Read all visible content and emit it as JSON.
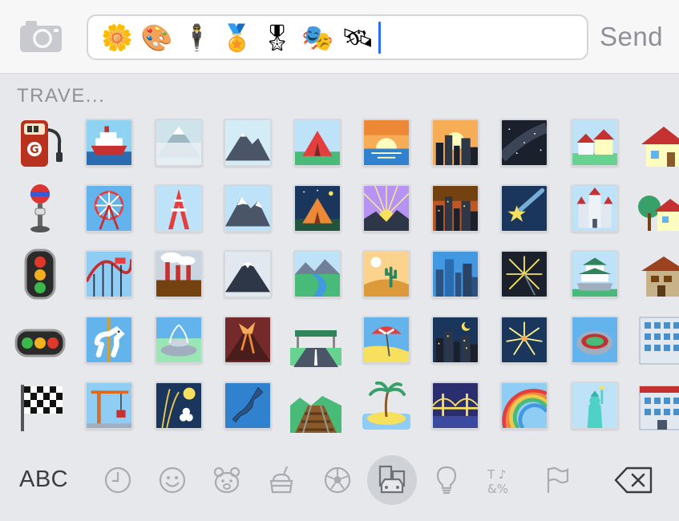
{
  "compose": {
    "send_label": "Send",
    "typed_emoji": [
      "🌼",
      "🎨",
      "🕴",
      "🏅",
      "🎖",
      "🎭",
      "🛰"
    ]
  },
  "emoji_panel": {
    "category_label": "TRAVE...",
    "columns": [
      [
        "fuel-pump",
        "busstop",
        "traffic-light-vertical",
        "traffic-light-horizontal",
        "checkered-flag"
      ],
      [
        "ship",
        "ferris-wheel",
        "roller-coaster",
        "carousel-horse",
        "construction-crane"
      ],
      [
        "mount-fuji-mist",
        "tokyo-tower",
        "factory",
        "fountain",
        "moon-viewing"
      ],
      [
        "mountain",
        "snow-mountain",
        "mount-fuji",
        "volcano",
        "japan-map"
      ],
      [
        "tent-day",
        "tent-night",
        "river-park",
        "motorway",
        "railway-track"
      ],
      [
        "sunrise",
        "sunrise-over-mountains",
        "desert",
        "beach-umbrella",
        "desert-island"
      ],
      [
        "city-sunset",
        "city-dusk",
        "cityscape",
        "night-city",
        "bridge-at-night"
      ],
      [
        "milky-way",
        "shooting-star",
        "sparkler",
        "fireworks",
        "rainbow"
      ],
      [
        "houses",
        "european-castle",
        "japanese-castle",
        "stadium",
        "statue-of-liberty"
      ],
      [
        "house",
        "house-with-garden",
        "derelict-house",
        "office-building",
        "hospital"
      ]
    ]
  },
  "keyboard_bar": {
    "abc_label": "ABC",
    "icons": [
      "clock-icon",
      "smiley-icon",
      "bear-icon",
      "food-icon",
      "ball-icon",
      "car-building-icon",
      "lightbulb-icon",
      "symbols-icon",
      "flag-icon",
      "backspace-icon"
    ],
    "selected": "car-building-icon"
  }
}
